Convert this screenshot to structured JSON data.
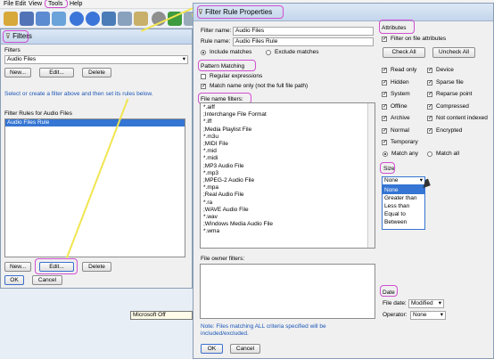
{
  "menubar": {
    "file": "File",
    "edit": "Edit",
    "view": "View",
    "tools": "Tools",
    "help": "Help"
  },
  "filters": {
    "title": "Filters",
    "section": "Filters",
    "selected": "Audio Files",
    "new": "New...",
    "edit": "Edit...",
    "delete": "Delete",
    "hint": "Select or create a filter above and then set its rules below.",
    "rules_label": "Filter Rules for Audio Files",
    "rules": [
      "Audio Files Rule"
    ],
    "ok": "OK",
    "cancel": "Cancel"
  },
  "background_tab": "Microsoft Off",
  "props": {
    "title": "Filter Rule Properties",
    "filter_name_label": "Filter name:",
    "filter_name": "Audio Files",
    "rule_name_label": "Rule name:",
    "rule_name": "Audio Files Rule",
    "include": "Include matches",
    "exclude": "Exclude matches",
    "pattern": "Pattern Matching",
    "regex": "Regular expressions",
    "match_name": "Match name only (not the full file path)",
    "file_name_filters": "File name filters:",
    "file_filters": [
      "*.aiff",
      ";Interchange File Format",
      "*.iff",
      ";Media Playlist File",
      "*.m3u",
      ";MIDI File",
      "*.mid",
      "*.midi",
      ";MP3 Audio File",
      "*.mp3",
      ";MPEG-2 Audio File",
      "*.mpa",
      ";Real Audio File",
      "*.ra",
      ";WAVE Audio File",
      "*.wav",
      ";Windows Media Audio File",
      "*.wma"
    ],
    "owner_filters": "File owner filters:",
    "note": "Note: Files matching ALL criteria specified will be included/excluded.",
    "ok": "OK",
    "cancel": "Cancel",
    "attributes": "Attributes",
    "filter_attrs": "Filter on file attributes",
    "check_all": "Check All",
    "uncheck_all": "Uncheck All",
    "attrs_left": [
      "Read only",
      "Hidden",
      "System",
      "Offline",
      "Archive",
      "Normal",
      "Temporary"
    ],
    "attrs_right": [
      "Device",
      "Sparse file",
      "Reparse point",
      "Compressed",
      "Not content indexed",
      "Encrypted"
    ],
    "match_any": "Match any",
    "match_all": "Match all",
    "size": "Size",
    "size_value": "None",
    "size_options": [
      "None",
      "Greater than",
      "Less than",
      "Equal to",
      "Between"
    ],
    "date": "Date",
    "file_date_label": "File date:",
    "file_date": "Modified",
    "operator_label": "Operator:",
    "operator": "None"
  }
}
